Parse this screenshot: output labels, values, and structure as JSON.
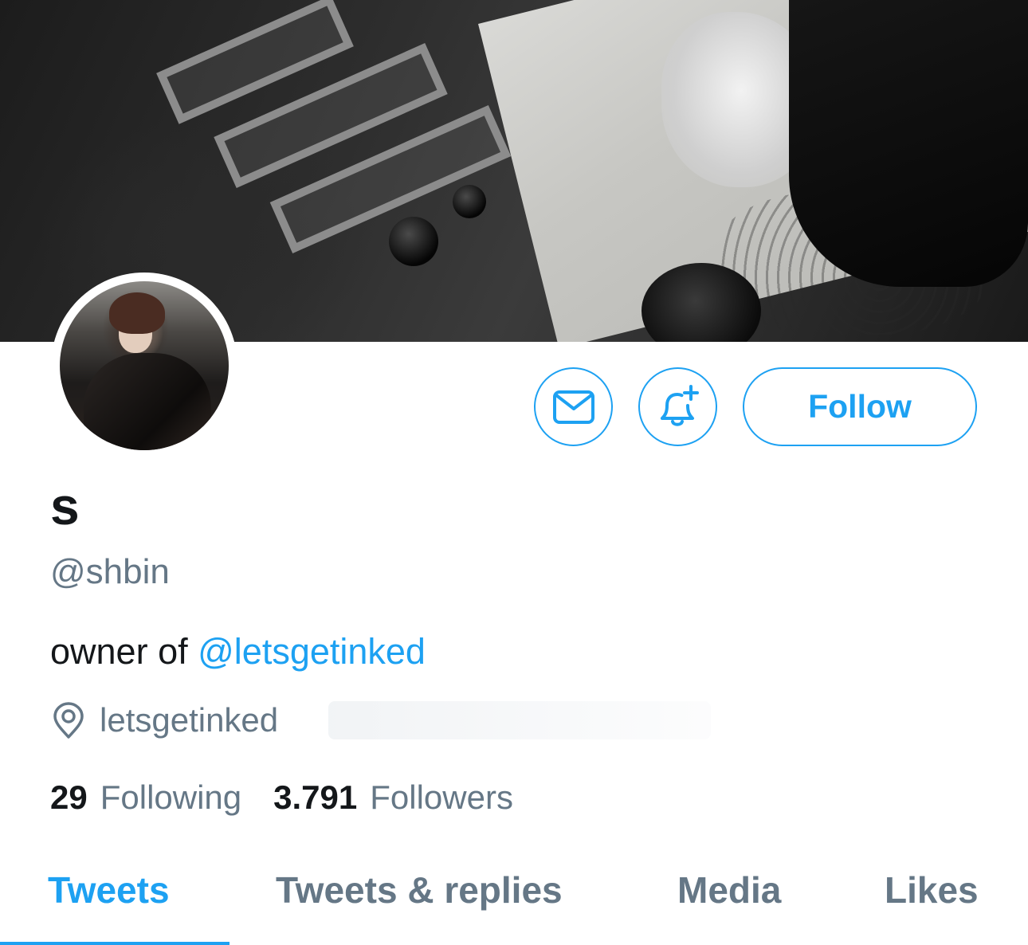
{
  "profile": {
    "display_name": "s",
    "handle": "@shbin",
    "bio_prefix": "owner of ",
    "bio_mention": "@letsgetinked",
    "location": "letsgetinked"
  },
  "actions": {
    "follow_label": "Follow",
    "message_icon": "envelope-icon",
    "notify_icon": "bell-plus-icon"
  },
  "stats": {
    "following_count": "29",
    "following_label": "Following",
    "followers_count": "3.791",
    "followers_label": "Followers"
  },
  "tabs": [
    {
      "label": "Tweets",
      "active": true
    },
    {
      "label": "Tweets & replies",
      "active": false
    },
    {
      "label": "Media",
      "active": false
    },
    {
      "label": "Likes",
      "active": false
    }
  ],
  "colors": {
    "accent": "#1da1f2",
    "secondary_text": "#657786",
    "primary_text": "#14171a"
  }
}
